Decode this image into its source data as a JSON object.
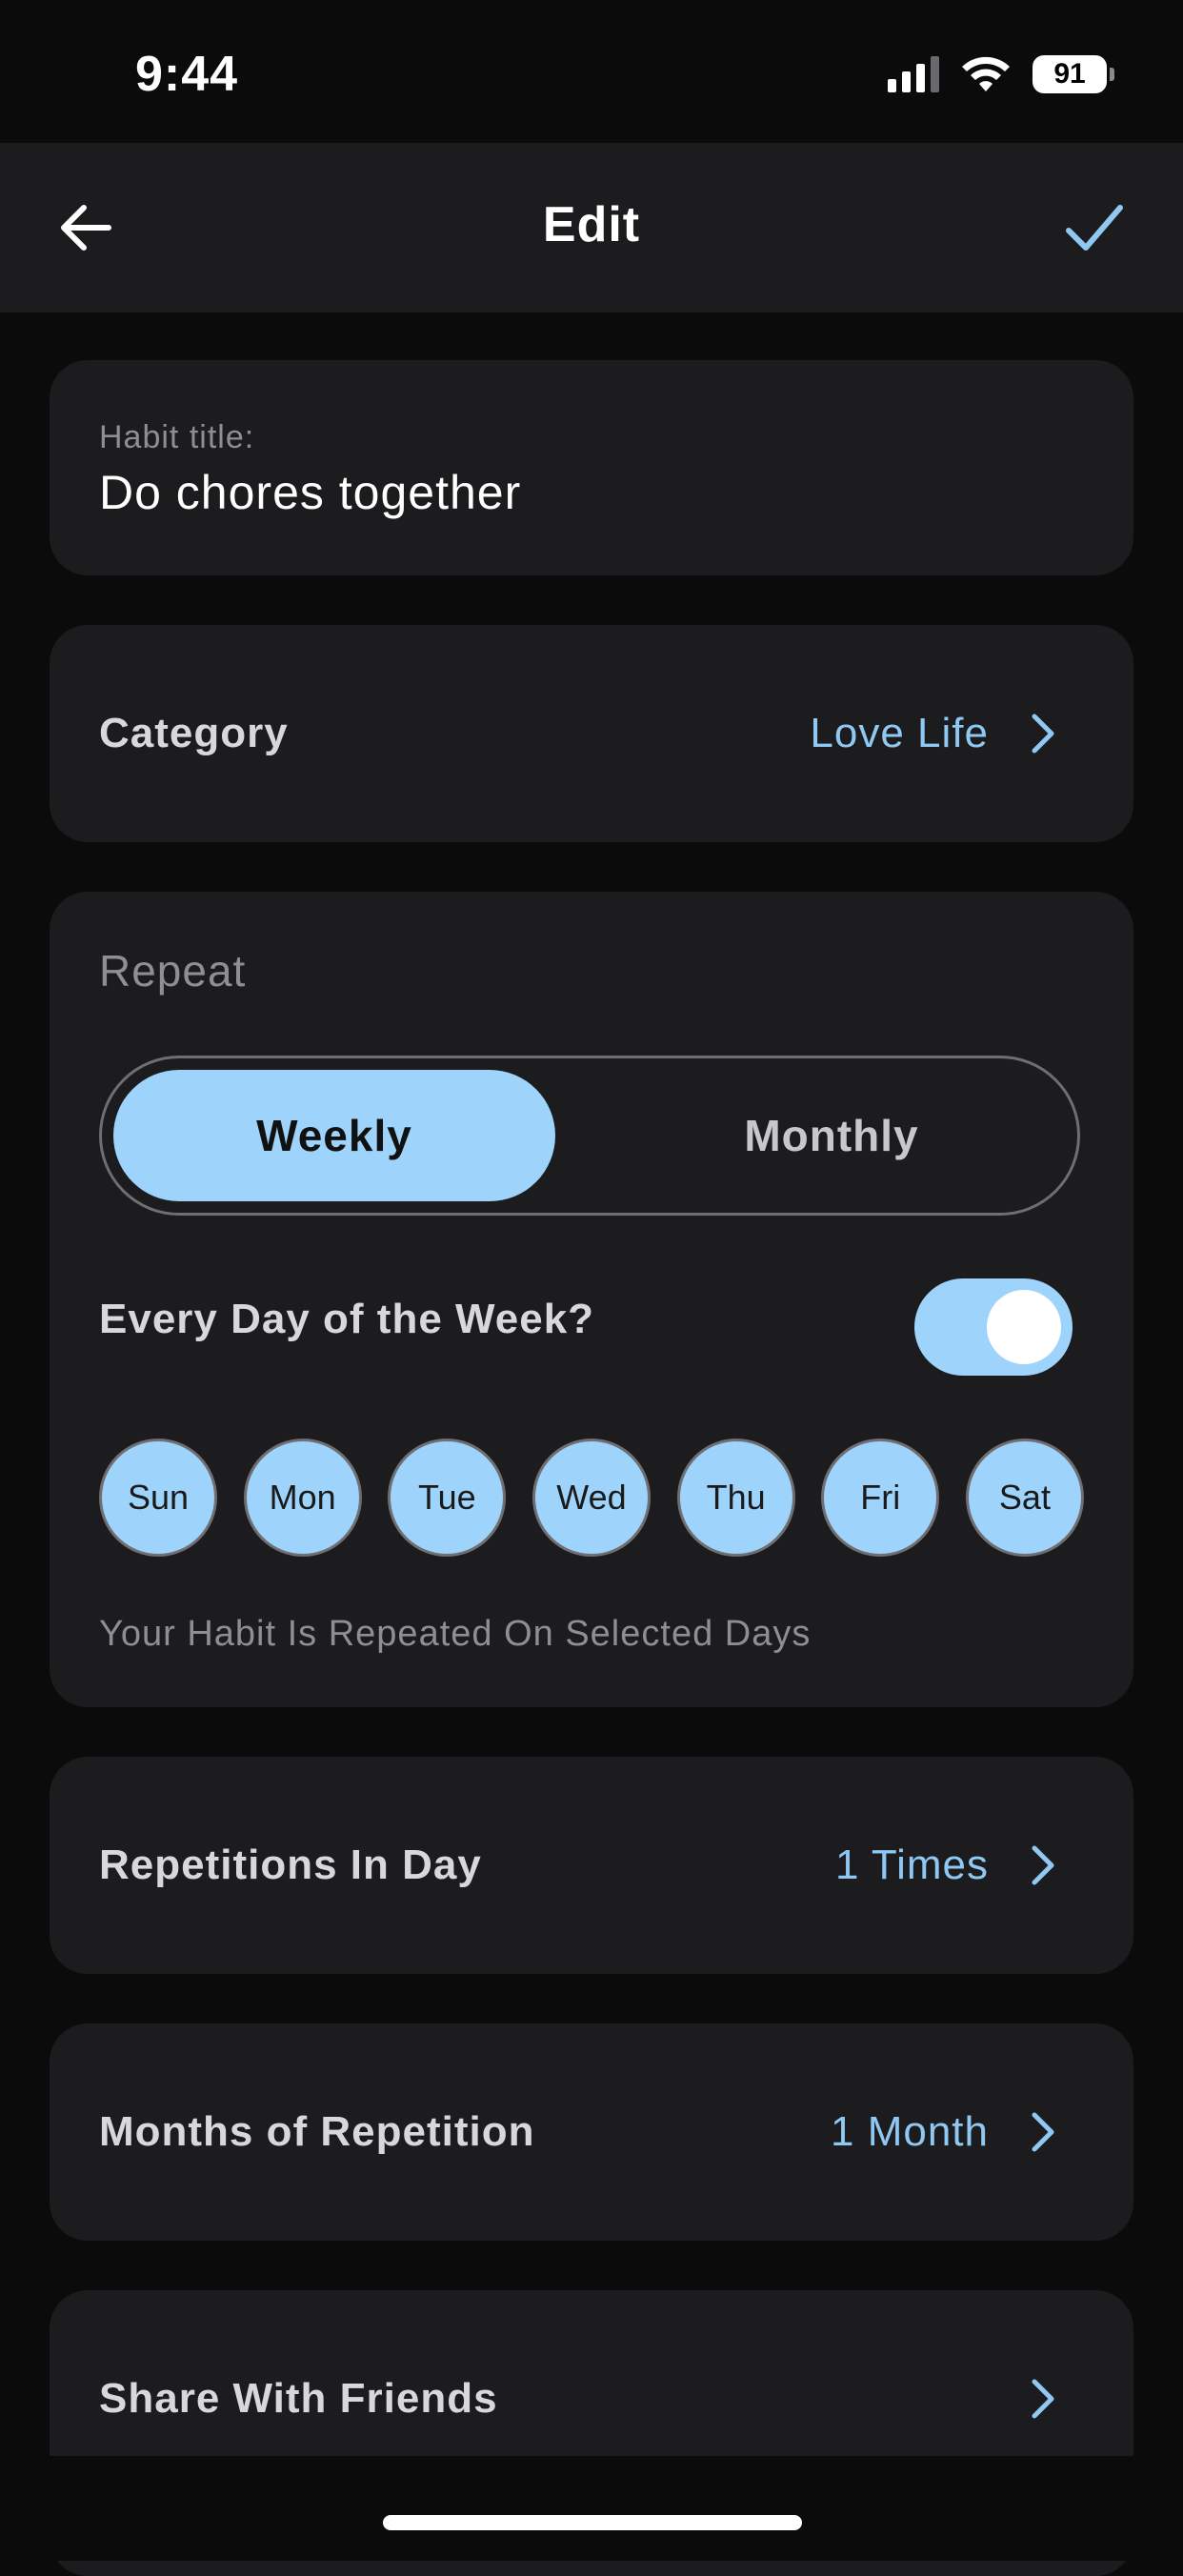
{
  "status_bar": {
    "time": "9:44",
    "battery": "91",
    "icons": [
      "signal-icon",
      "wifi-icon",
      "battery-icon"
    ]
  },
  "nav": {
    "title": "Edit",
    "back_icon": "arrow-left-icon",
    "confirm_icon": "checkmark-icon"
  },
  "habit": {
    "title_label": "Habit title:",
    "title_value": "Do chores together"
  },
  "category": {
    "label": "Category",
    "value": "Love Life"
  },
  "repeat": {
    "title": "Repeat",
    "options": [
      "Weekly",
      "Monthly"
    ],
    "selected": "Weekly",
    "every_day_label": "Every Day of the Week?",
    "every_day_enabled": true,
    "days": [
      "Sun",
      "Mon",
      "Tue",
      "Wed",
      "Thu",
      "Fri",
      "Sat"
    ],
    "hint": "Your Habit Is Repeated On Selected Days"
  },
  "repetitions": {
    "label": "Repetitions In Day",
    "value": "1 Times"
  },
  "months": {
    "label": "Months of Repetition",
    "value": "1 Month"
  },
  "share": {
    "label": "Share With Friends"
  },
  "colors": {
    "accent": "#9ed4fb",
    "value_text": "#8fc8f2",
    "card": "#1c1c1e",
    "background": "#0b0b0c"
  }
}
